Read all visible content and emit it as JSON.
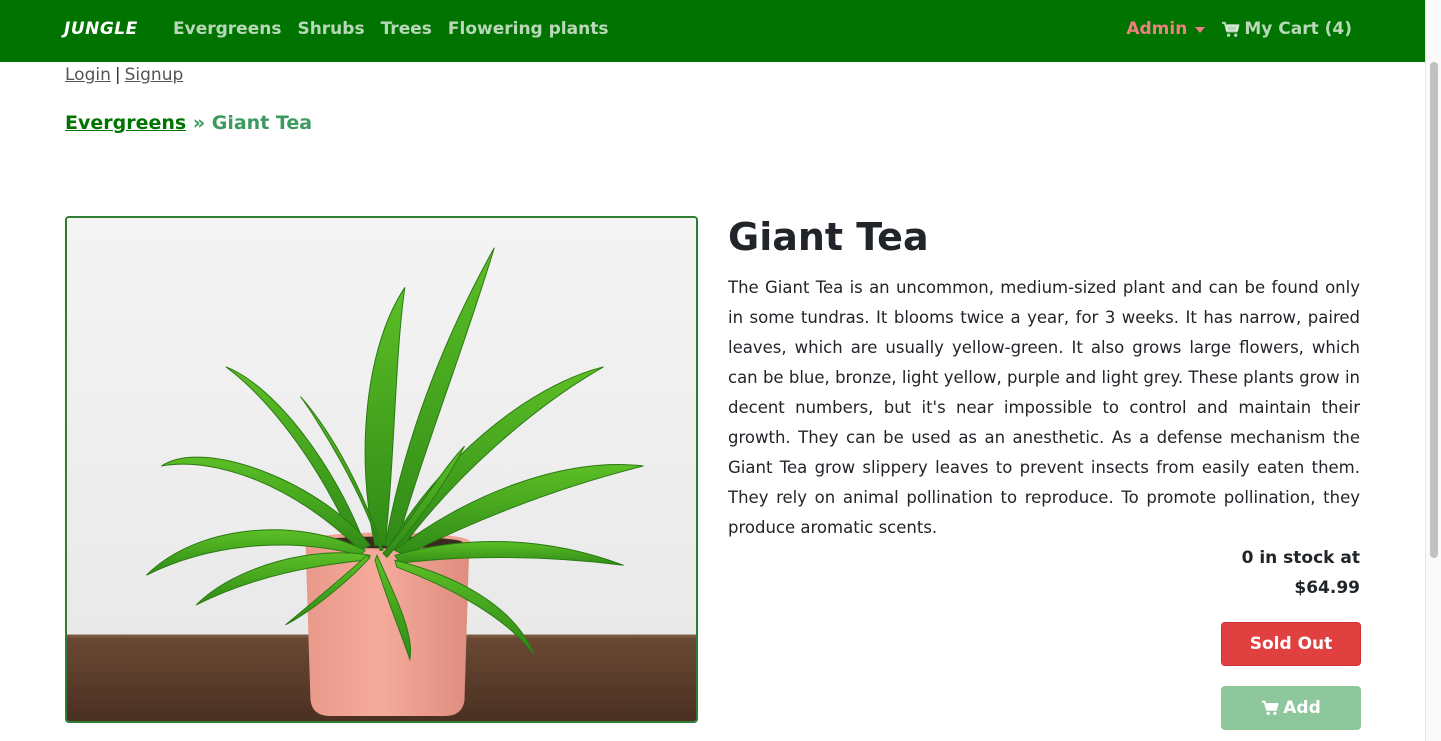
{
  "nav": {
    "brand": "JUNGLE",
    "links": [
      "Evergreens",
      "Shrubs",
      "Trees",
      "Flowering plants"
    ],
    "admin_label": "Admin",
    "cart_label": "My Cart (4)"
  },
  "auth": {
    "login": "Login",
    "separator": "|",
    "signup": "Signup"
  },
  "breadcrumb": {
    "category": "Evergreens",
    "separator": "»",
    "current": "Giant Tea"
  },
  "product": {
    "name": "Giant Tea",
    "description": "The Giant Tea is an uncommon, medium-sized plant and can be found only in some tundras. It blooms twice a year, for 3 weeks. It has narrow, paired leaves, which are usually yellow-green. It also grows large flowers, which can be blue, bronze, light yellow, purple and light grey. These plants grow in decent numbers, but it's near impossible to control and maintain their growth. They can be used as an anesthetic. As a defense mechanism the Giant Tea grow slippery leaves to prevent insects from easily eaten them. They rely on animal pollination to reproduce. To promote pollination, they produce aromatic scents.",
    "stock_line": "0 in stock at",
    "price": "$64.99",
    "sold_out_label": "Sold Out",
    "add_label": "Add"
  },
  "colors": {
    "navbar": "#007300",
    "admin": "#f08080",
    "sold_out": "#e04040",
    "add_disabled": "#8fc79c",
    "image_border": "#2e7d32"
  },
  "icons": {
    "cart": "shopping-cart-icon",
    "caret": "caret-down-icon"
  }
}
